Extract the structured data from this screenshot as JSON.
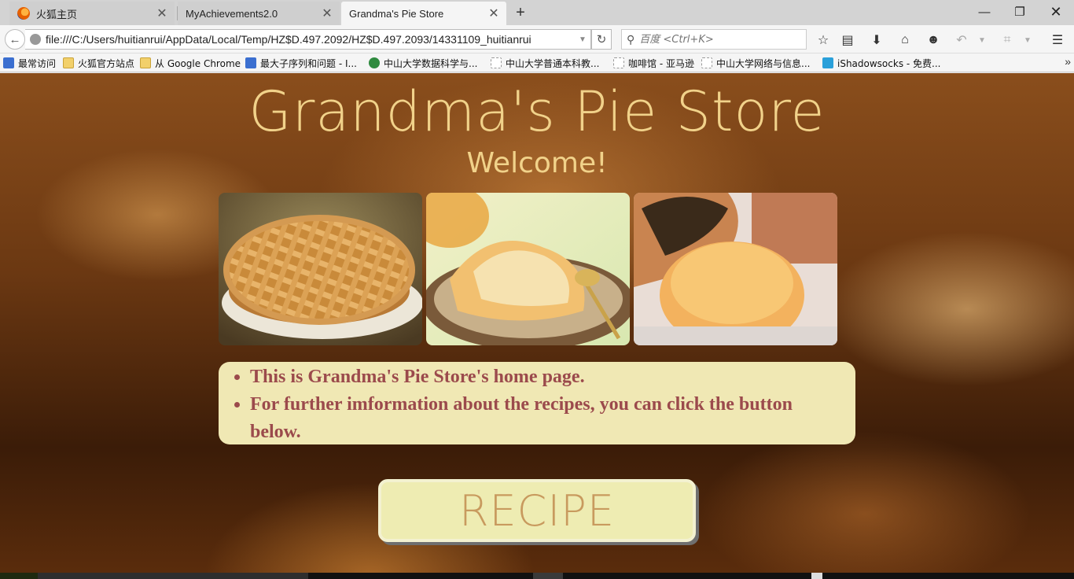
{
  "browser": {
    "tabs": [
      {
        "title": "火狐主页",
        "active": false
      },
      {
        "title": "MyAchievements2.0",
        "active": false
      },
      {
        "title": "Grandma's Pie Store",
        "active": true
      }
    ],
    "url": "file:///C:/Users/huitianrui/AppData/Local/Temp/HZ$D.497.2092/HZ$D.497.2093/14331109_huitianrui",
    "search_placeholder": "百度 <Ctrl+K>",
    "bookmarks": [
      {
        "label": "最常访问",
        "icon": "most-visited-icon"
      },
      {
        "label": "火狐官方站点",
        "icon": "folder-icon"
      },
      {
        "label": "从 Google Chrome",
        "icon": "folder-icon"
      },
      {
        "label": "最大子序列和问题 - I...",
        "icon": "site-icon"
      },
      {
        "label": "中山大学数据科学与...",
        "icon": "sysu-icon"
      },
      {
        "label": "中山大学普通本科教...",
        "icon": "page-icon"
      },
      {
        "label": "咖啡馆 - 亚马逊",
        "icon": "page-icon"
      },
      {
        "label": "中山大学网络与信息...",
        "icon": "page-icon"
      },
      {
        "label": "iShadowsocks - 免费...",
        "icon": "telegram-icon"
      }
    ]
  },
  "page": {
    "title": "Grandma's Pie Store",
    "subtitle": "Welcome!",
    "info_items": [
      "This is Grandma's Pie Store's home page.",
      "For further imformation about the recipes, you can click the button below."
    ],
    "button_label": "RECIPE"
  },
  "colors": {
    "title": "#f1d28a",
    "info_background": "#f0e8b4",
    "info_text": "#9b4a4c",
    "button_background": "#eeecb2",
    "button_text": "#c89a5e"
  }
}
